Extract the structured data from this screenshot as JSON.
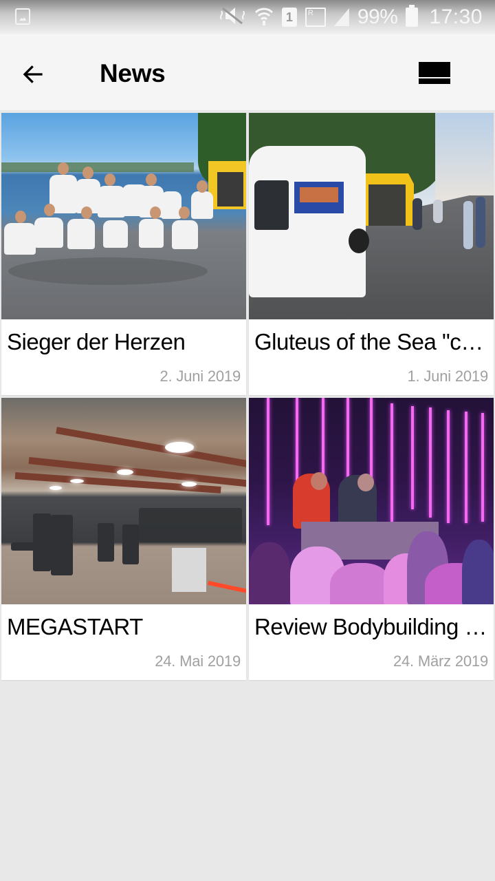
{
  "status_bar": {
    "notification_icon": "image-icon",
    "icons": [
      "vibrate-mute-icon",
      "wifi-icon",
      "sim-1-icon",
      "roaming-signal-icon",
      "signal-icon"
    ],
    "sim_label": "1",
    "roaming_label": "R",
    "battery_percent": "99%",
    "battery_icon": "battery-icon",
    "time": "17:30"
  },
  "app_bar": {
    "back_icon": "arrow-left-icon",
    "title": "News",
    "view_toggle_icon": "view-list-icon"
  },
  "news": [
    {
      "title": "Sieger der Herzen",
      "date": "2. Juni 2019",
      "image": "group-photo-waterfront"
    },
    {
      "title": "Gluteus of the Sea \"cle…",
      "date": "1. Juni 2019",
      "image": "van-and-tent-photo"
    },
    {
      "title": "MEGASTART",
      "date": "24. Mai 2019",
      "image": "gym-interior-photo"
    },
    {
      "title": "Review Bodybuilding S…",
      "date": "24. März 2019",
      "image": "stage-event-photo"
    }
  ],
  "colors": {
    "app_bar_bg": "#f5f5f5",
    "page_bg": "#e8e8e8",
    "card_bg": "#ffffff",
    "title_text": "#000000",
    "date_text": "#a0a0a0"
  }
}
